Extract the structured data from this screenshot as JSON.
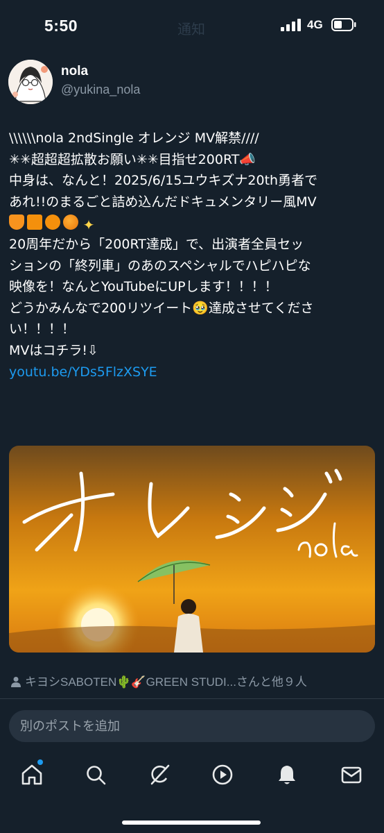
{
  "status_bar": {
    "time": "5:50",
    "network": "4G",
    "ghost_title": "通知"
  },
  "author": {
    "name": "nola",
    "handle": "@yukina_nola"
  },
  "tweet": {
    "lines": [
      "\\\\\\\\\\\\nola 2ndSingle オレンジ MV解禁////",
      "✳✳超超超拡散お願い✳✳目指せ200RT📣",
      "中身は、なんと！2025/6/15ユウキズナ20th勇者で",
      "あれ!!のまるごと詰め込んだドキュメンタリー風MV",
      "",
      "20周年だから「200RT達成」で、出演者全員セッ",
      "ションの「終列車」のあのスペシャルでハピハピな",
      "映像を！なんとYouTubeにUPします！！！！",
      "どうかみんなで200リツイート🥹達成させてくださ",
      "い！！！！",
      "MVはコチラ!⇩"
    ],
    "link": "youtu.be/YDs5FlzXSYE"
  },
  "media": {
    "title": "オレンジ",
    "artist": "nola"
  },
  "likers": {
    "text": "キヨシSABOTEN🌵🎸GREEN STUDI...さんと他９人"
  },
  "reply": {
    "placeholder": "別のポストを追加"
  },
  "nav": {
    "items": [
      "home-icon",
      "search-icon",
      "grok-icon",
      "video-icon",
      "notifications-icon",
      "messages-icon"
    ]
  },
  "colors": {
    "background": "#15202b",
    "accent": "#1d9bf0",
    "secondary_text": "#8b98a5"
  }
}
